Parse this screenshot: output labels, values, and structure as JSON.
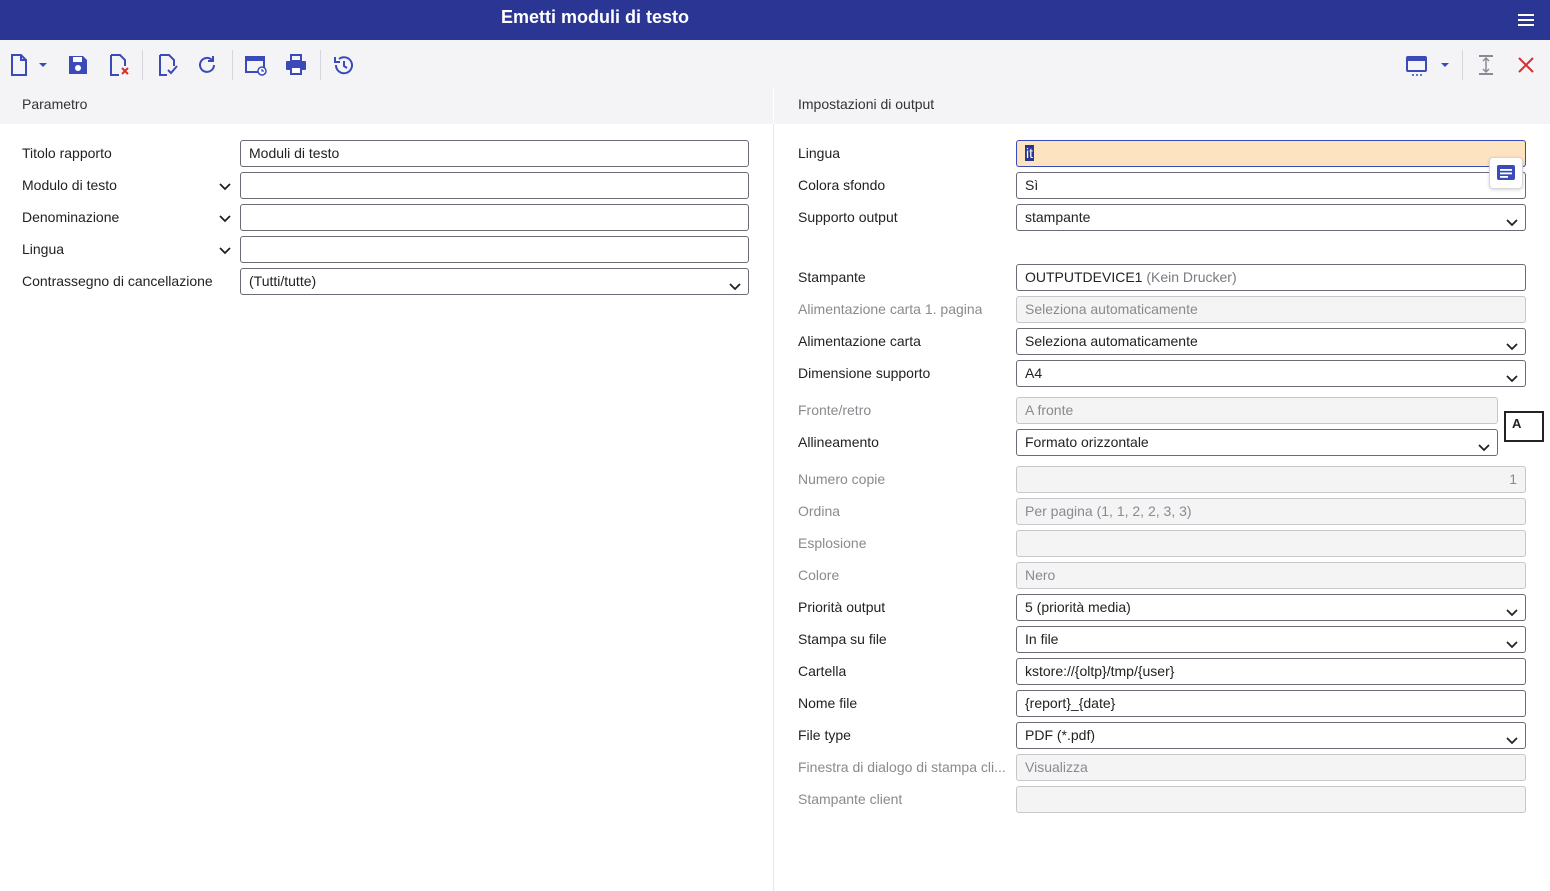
{
  "app": {
    "title": "Emetti moduli di testo"
  },
  "toolbar": {
    "icons": [
      "new-document-icon",
      "dropdown-arrow-icon",
      "save-icon",
      "discard-icon",
      "check-document-icon",
      "refresh-icon",
      "schedule-icon",
      "print-icon",
      "reset-icon",
      "layout-icon",
      "collapse-icon",
      "close-icon"
    ]
  },
  "left": {
    "section_title": "Parametro",
    "fields": [
      {
        "label": "Titolo rapporto",
        "value": "Moduli di testo"
      },
      {
        "label": "Modulo di testo",
        "value": ""
      },
      {
        "label": "Denominazione",
        "value": ""
      },
      {
        "label": "Lingua",
        "value": ""
      },
      {
        "label": "Contrassegno di cancellazione",
        "value": "(Tutti/tutte)"
      }
    ]
  },
  "right": {
    "section_title": "Impostazioni di output",
    "fields": [
      {
        "label": "Lingua",
        "value": "it"
      },
      {
        "label": "Colora sfondo",
        "value": "Sì"
      },
      {
        "label": "Supporto output",
        "value": "stampante"
      },
      {
        "label": "Stampante",
        "value": "OUTPUTDEVICE1",
        "value_suffix": "(Kein Drucker)"
      },
      {
        "label": "Alimentazione carta 1. pagina",
        "value": "Seleziona automaticamente"
      },
      {
        "label": "Alimentazione carta",
        "value": "Seleziona automaticamente"
      },
      {
        "label": "Dimensione supporto",
        "value": "A4"
      },
      {
        "label": "Fronte/retro",
        "value": "A fronte"
      },
      {
        "label": "Allineamento",
        "value": "Formato orizzontale"
      },
      {
        "label": "Numero copie",
        "value": "1"
      },
      {
        "label": "Ordina",
        "value": "Per pagina (1, 1, 2, 2, 3, 3)"
      },
      {
        "label": "Esplosione",
        "value": ""
      },
      {
        "label": "Colore",
        "value": "Nero"
      },
      {
        "label": "Priorità output",
        "value": "5 (priorità media)"
      },
      {
        "label": "Stampa su file",
        "value": "In file"
      },
      {
        "label": "Cartella",
        "value": "kstore://{oltp}/tmp/{user}"
      },
      {
        "label": "Nome file",
        "value": "{report}_{date}"
      },
      {
        "label": "File type",
        "value": "PDF (*.pdf)"
      },
      {
        "label": "Finestra di dialogo di stampa cli...",
        "value": "Visualizza"
      },
      {
        "label": "Stampante client",
        "value": ""
      }
    ]
  },
  "side": {
    "float_icon": "details-icon",
    "a_label": "A"
  },
  "colors": {
    "header": "#2b3694",
    "accent": "#3a4ab8",
    "focus_bg": "#fde3c0",
    "close_red": "#d32f2f"
  }
}
